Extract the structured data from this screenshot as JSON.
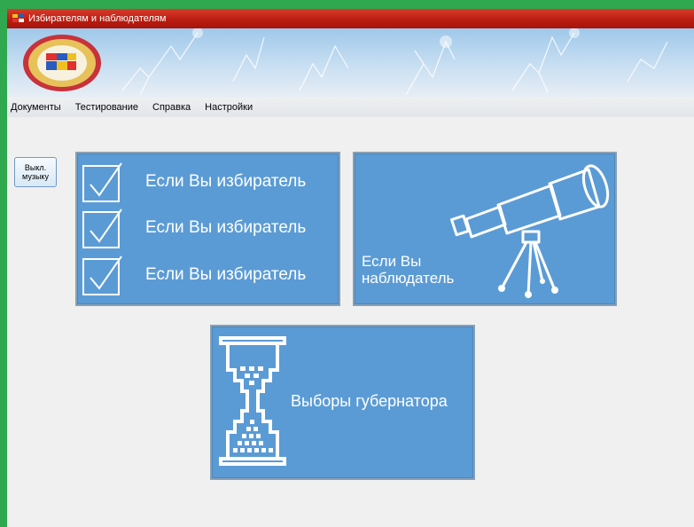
{
  "window": {
    "title": "Избирателям и наблюдателям"
  },
  "menu": {
    "items": [
      "Документы",
      "Тестирование",
      "Справка",
      "Настройки"
    ]
  },
  "music_button": {
    "line1": "Выкл.",
    "line2": "музыку"
  },
  "tiles": {
    "voter": {
      "lines": [
        "Если Вы избиратель",
        "Если Вы избиратель",
        "Если Вы избиратель"
      ],
      "icon": "checkbox-icon"
    },
    "observer": {
      "line1": "Если Вы",
      "line2": "наблюдатель",
      "icon": "telescope-icon"
    },
    "governor": {
      "label": "Выборы губернатора",
      "icon": "hourglass-icon"
    }
  },
  "colors": {
    "tile": "#5b9bd5",
    "titlebar": "#c2261a",
    "frame": "#2fa84f"
  }
}
